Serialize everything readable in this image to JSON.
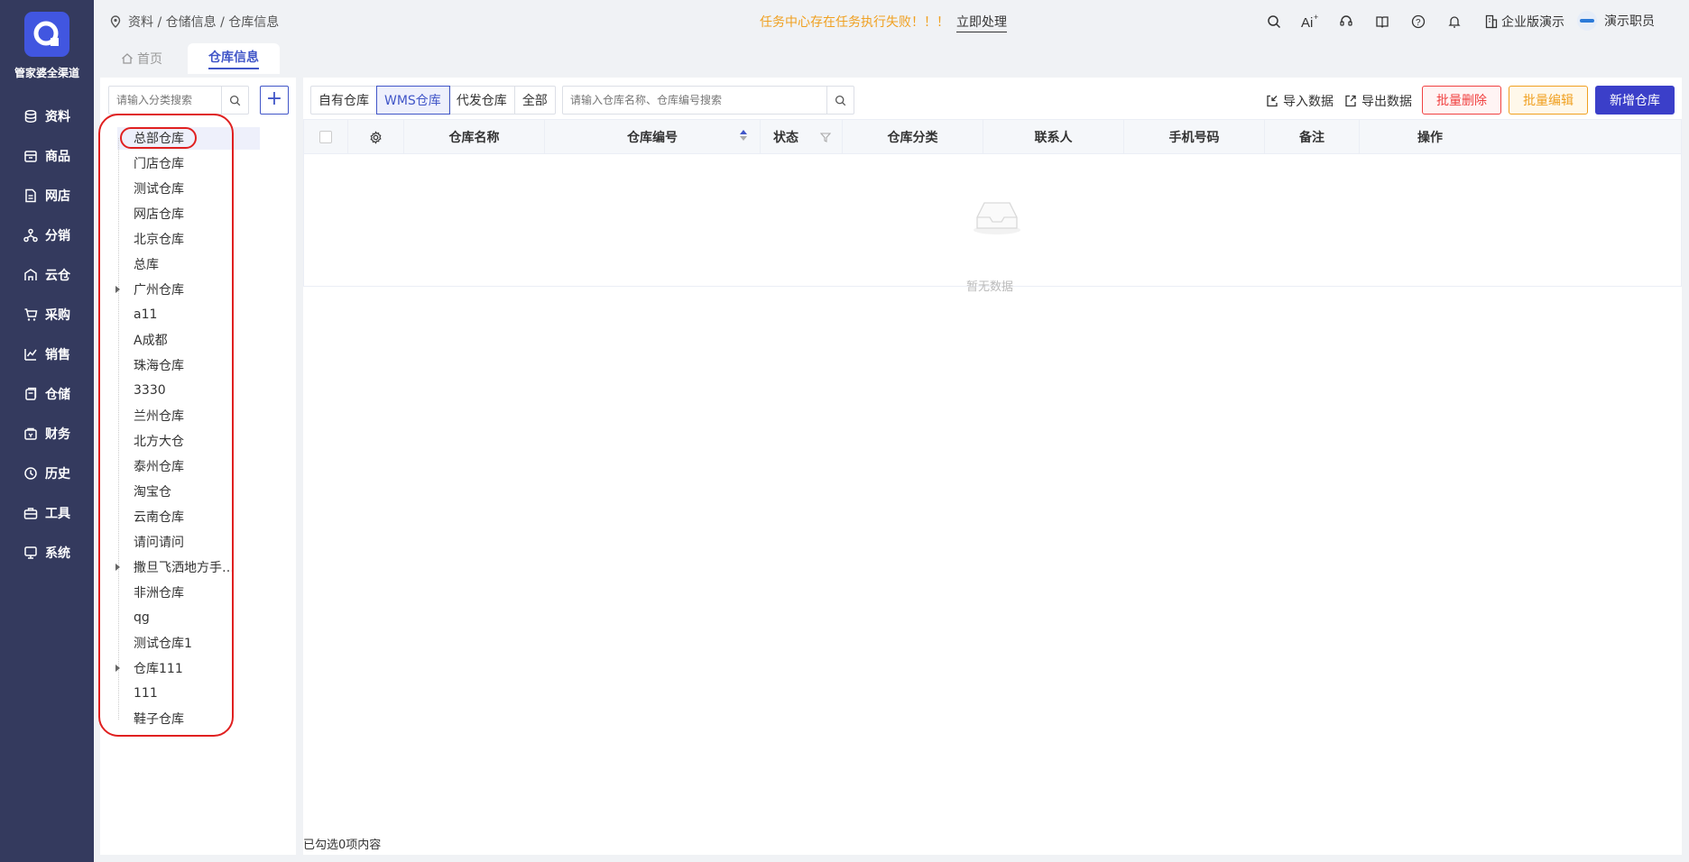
{
  "app": {
    "name": "管家婆全渠道"
  },
  "sidebar": {
    "items": [
      {
        "label": "资料",
        "icon": "database-icon"
      },
      {
        "label": "商品",
        "icon": "box-icon"
      },
      {
        "label": "网店",
        "icon": "document-icon"
      },
      {
        "label": "分销",
        "icon": "network-icon"
      },
      {
        "label": "云仓",
        "icon": "cloud-warehouse-icon"
      },
      {
        "label": "采购",
        "icon": "cart-icon"
      },
      {
        "label": "销售",
        "icon": "chart-icon"
      },
      {
        "label": "仓储",
        "icon": "storage-icon"
      },
      {
        "label": "财务",
        "icon": "wallet-icon"
      },
      {
        "label": "历史",
        "icon": "history-icon"
      },
      {
        "label": "工具",
        "icon": "toolbox-icon"
      },
      {
        "label": "系统",
        "icon": "monitor-icon"
      }
    ]
  },
  "header": {
    "breadcrumb": "资料 / 仓储信息 / 仓库信息",
    "notice": "任务中心存在任务执行失败！！！",
    "notice_action": "立即处理",
    "enterprise": "企业版演示",
    "user": "演示职员"
  },
  "tabs": {
    "home": "首页",
    "active": "仓库信息"
  },
  "left_panel": {
    "search_placeholder": "请输入分类搜索",
    "add_label": "+",
    "tree": [
      {
        "label": "总部仓库",
        "expandable": false,
        "selected": true
      },
      {
        "label": "门店仓库",
        "expandable": false
      },
      {
        "label": "测试仓库",
        "expandable": false
      },
      {
        "label": "网店仓库",
        "expandable": false
      },
      {
        "label": "北京仓库",
        "expandable": false
      },
      {
        "label": "总库",
        "expandable": false
      },
      {
        "label": "广州仓库",
        "expandable": true
      },
      {
        "label": "a11",
        "expandable": false
      },
      {
        "label": "A成都",
        "expandable": false
      },
      {
        "label": "珠海仓库",
        "expandable": false
      },
      {
        "label": "3330",
        "expandable": false
      },
      {
        "label": "兰州仓库",
        "expandable": false
      },
      {
        "label": "北方大仓",
        "expandable": false
      },
      {
        "label": "泰州仓库",
        "expandable": false
      },
      {
        "label": "淘宝仓",
        "expandable": false
      },
      {
        "label": "云南仓库",
        "expandable": false
      },
      {
        "label": "请问请问",
        "expandable": false
      },
      {
        "label": "撒旦飞洒地方手…",
        "expandable": true
      },
      {
        "label": "非洲仓库",
        "expandable": false
      },
      {
        "label": "qg",
        "expandable": false
      },
      {
        "label": "测试仓库1",
        "expandable": false
      },
      {
        "label": "仓库111",
        "expandable": true
      },
      {
        "label": "111",
        "expandable": false
      },
      {
        "label": "鞋子仓库",
        "expandable": false
      }
    ]
  },
  "main": {
    "filters": [
      "自有仓库",
      "WMS仓库",
      "代发仓库",
      "全部"
    ],
    "active_filter": "WMS仓库",
    "search_placeholder": "请输入仓库名称、仓库编号搜索",
    "import_label": "导入数据",
    "export_label": "导出数据",
    "batch_delete_label": "批量删除",
    "batch_edit_label": "批量编辑",
    "new_label": "新增仓库",
    "columns": [
      "仓库名称",
      "仓库编号",
      "状态",
      "仓库分类",
      "联系人",
      "手机号码",
      "备注",
      "操作"
    ],
    "rows": [],
    "empty_text": "暂无数据",
    "selected_text": "已勾选0项内容"
  },
  "colors": {
    "sidebar": "#343a5e",
    "accent": "#4156c8",
    "danger": "#f04040",
    "warning": "#f0a020"
  }
}
